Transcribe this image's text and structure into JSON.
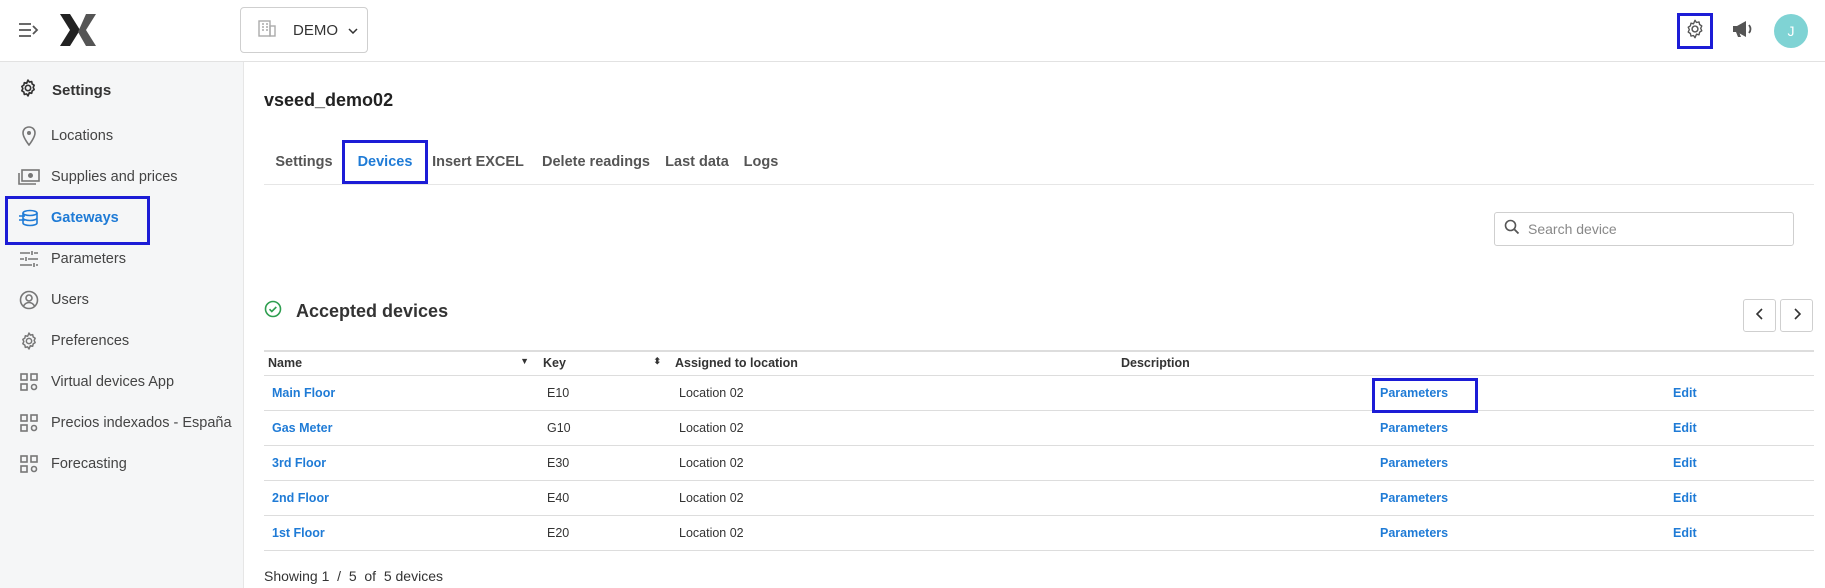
{
  "header": {
    "company": "DEMO",
    "avatar_initial": "J",
    "icons": [
      "menu-toggle-icon",
      "logo",
      "building-icon",
      "chevron-down-icon",
      "gear-icon",
      "megaphone-icon"
    ]
  },
  "sidebar": {
    "title": "Settings",
    "items": [
      {
        "label": "Locations",
        "icon": "location-pin-icon"
      },
      {
        "label": "Supplies and prices",
        "icon": "money-icon"
      },
      {
        "label": "Gateways",
        "icon": "gateway-icon",
        "active": true
      },
      {
        "label": "Parameters",
        "icon": "sliders-icon"
      },
      {
        "label": "Users",
        "icon": "user-icon"
      },
      {
        "label": "Preferences",
        "icon": "gear-icon"
      },
      {
        "label": "Virtual devices App",
        "icon": "apps-icon"
      },
      {
        "label": "Precios indexados - España",
        "icon": "apps-icon"
      },
      {
        "label": "Forecasting",
        "icon": "apps-icon"
      }
    ]
  },
  "main": {
    "title": "vseed_demo02",
    "tabs": [
      {
        "label": "Settings"
      },
      {
        "label": "Devices",
        "active": true
      },
      {
        "label": "Insert EXCEL"
      },
      {
        "label": "Delete readings"
      },
      {
        "label": "Last data"
      },
      {
        "label": "Logs"
      }
    ],
    "search_placeholder": "Search device",
    "section_title": "Accepted devices",
    "columns": [
      "Name",
      "Key",
      "Assigned to location",
      "Description",
      "",
      ""
    ],
    "rows": [
      {
        "name": "Main Floor",
        "key": "E10",
        "location": "Location 02",
        "description": "",
        "action": "Parameters",
        "edit": "Edit"
      },
      {
        "name": "Gas Meter",
        "key": "G10",
        "location": "Location 02",
        "description": "",
        "action": "Parameters",
        "edit": "Edit"
      },
      {
        "name": "3rd Floor",
        "key": "E30",
        "location": "Location 02",
        "description": "",
        "action": "Parameters",
        "edit": "Edit"
      },
      {
        "name": "2nd Floor",
        "key": "E40",
        "location": "Location 02",
        "description": "",
        "action": "Parameters",
        "edit": "Edit"
      },
      {
        "name": "1st Floor",
        "key": "E20",
        "location": "Location 02",
        "description": "",
        "action": "Parameters",
        "edit": "Edit"
      }
    ],
    "footer": "Showing 1  /  5  of  5 devices"
  },
  "colors": {
    "accent": "#1f7bd6",
    "highlight": "#1c1cd6",
    "avatar": "#7fd3d4",
    "success": "#2e9e4f"
  }
}
